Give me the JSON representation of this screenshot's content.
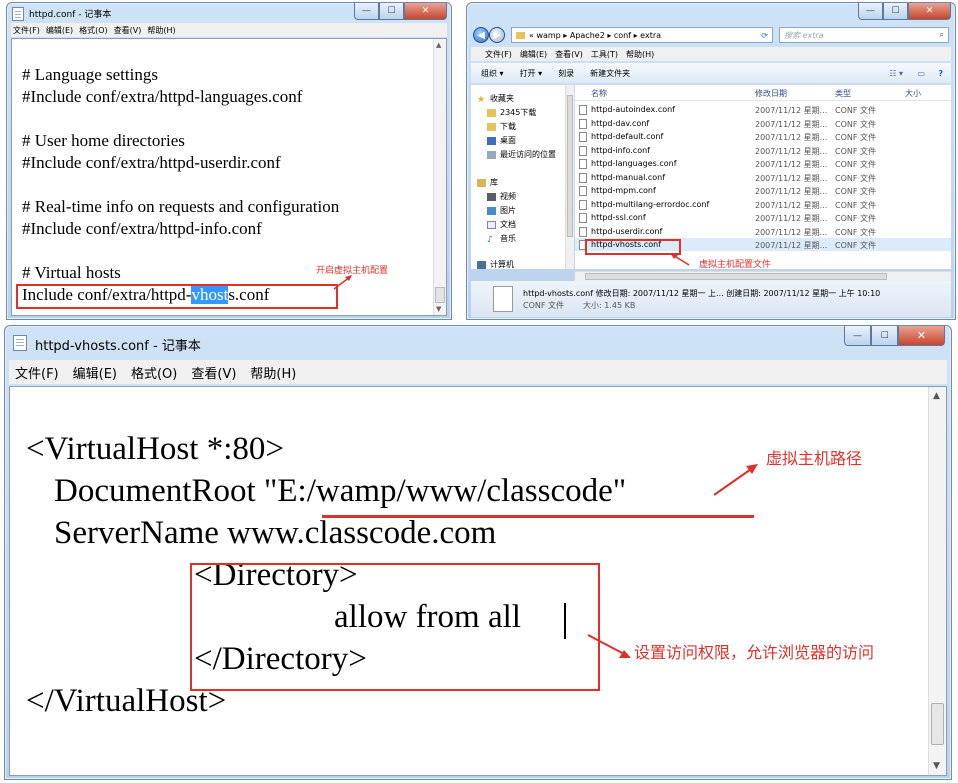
{
  "win1": {
    "title": "httpd.conf - 记事本",
    "menu": [
      "文件(F)",
      "编辑(E)",
      "格式(O)",
      "查看(V)",
      "帮助(H)"
    ],
    "lines": [
      "# Language settings",
      "#Include conf/extra/httpd-languages.conf",
      "",
      "# User home directories",
      "#Include conf/extra/httpd-userdir.conf",
      "",
      "# Real-time info on requests and configuration",
      "#Include conf/extra/httpd-info.conf",
      "",
      "# Virtual hosts"
    ],
    "include_prefix": "Include conf/extra/httpd-",
    "include_selected": "vhost",
    "include_suffix": "s.conf",
    "annotation": "开启虚拟主机配置"
  },
  "win2": {
    "breadcrumb": "« wamp ▸ Apache2 ▸ conf ▸ extra",
    "search_placeholder": "搜索 extra",
    "menu": [
      "文件(F)",
      "编辑(E)",
      "查看(V)",
      "工具(T)",
      "帮助(H)"
    ],
    "toolbar": [
      "组织 ▾",
      "打开 ▾",
      "刻录",
      "新建文件夹"
    ],
    "nav": {
      "favorites": "收藏夹",
      "items": [
        "2345下载",
        "下载",
        "桌面",
        "最近访问的位置"
      ],
      "library": "库",
      "lib_items": [
        "视频",
        "图片",
        "文档",
        "音乐"
      ],
      "computer": "计算机"
    },
    "columns": [
      "名称",
      "修改日期",
      "类型",
      "大小"
    ],
    "files": [
      {
        "name": "httpd-autoindex.conf",
        "date": "2007/11/12 星期...",
        "type": "CONF 文件"
      },
      {
        "name": "httpd-dav.conf",
        "date": "2007/11/12 星期...",
        "type": "CONF 文件"
      },
      {
        "name": "httpd-default.conf",
        "date": "2007/11/12 星期...",
        "type": "CONF 文件"
      },
      {
        "name": "httpd-info.conf",
        "date": "2007/11/12 星期...",
        "type": "CONF 文件"
      },
      {
        "name": "httpd-languages.conf",
        "date": "2007/11/12 星期...",
        "type": "CONF 文件"
      },
      {
        "name": "httpd-manual.conf",
        "date": "2007/11/12 星期...",
        "type": "CONF 文件"
      },
      {
        "name": "httpd-mpm.conf",
        "date": "2007/11/12 星期...",
        "type": "CONF 文件"
      },
      {
        "name": "httpd-multilang-errordoc.conf",
        "date": "2007/11/12 星期...",
        "type": "CONF 文件"
      },
      {
        "name": "httpd-ssl.conf",
        "date": "2007/11/12 星期...",
        "type": "CONF 文件"
      },
      {
        "name": "httpd-userdir.conf",
        "date": "2007/11/12 星期...",
        "type": "CONF 文件"
      },
      {
        "name": "httpd-vhosts.conf",
        "date": "2007/11/12 星期...",
        "type": "CONF 文件"
      }
    ],
    "annotation": "虚拟主机配置文件",
    "details": {
      "line1": "httpd-vhosts.conf 修改日期: 2007/11/12 星期一 上... 创建日期: 2007/11/12 星期一 上午 10:10",
      "line2a": "CONF 文件",
      "line2b": "大小: 1.45 KB"
    }
  },
  "win3": {
    "title": "httpd-vhosts.conf - 记事本",
    "menu": [
      "文件(F)",
      "编辑(E)",
      "格式(O)",
      "查看(V)",
      "帮助(H)"
    ],
    "lines": [
      "<VirtualHost *:80>",
      "DocumentRoot \"E:/wamp/www/classcode\"",
      "ServerName www.classcode.com",
      "<Directory>",
      "allow from all",
      "</Directory>",
      "</VirtualHost>"
    ],
    "annotation_path": "虚拟主机路径",
    "annotation_access": "设置访问权限，允许浏览器的访问"
  },
  "colors": {
    "annotation": "#e0302a",
    "selection": "#3399ff",
    "title_bg": "#c4daf1"
  }
}
